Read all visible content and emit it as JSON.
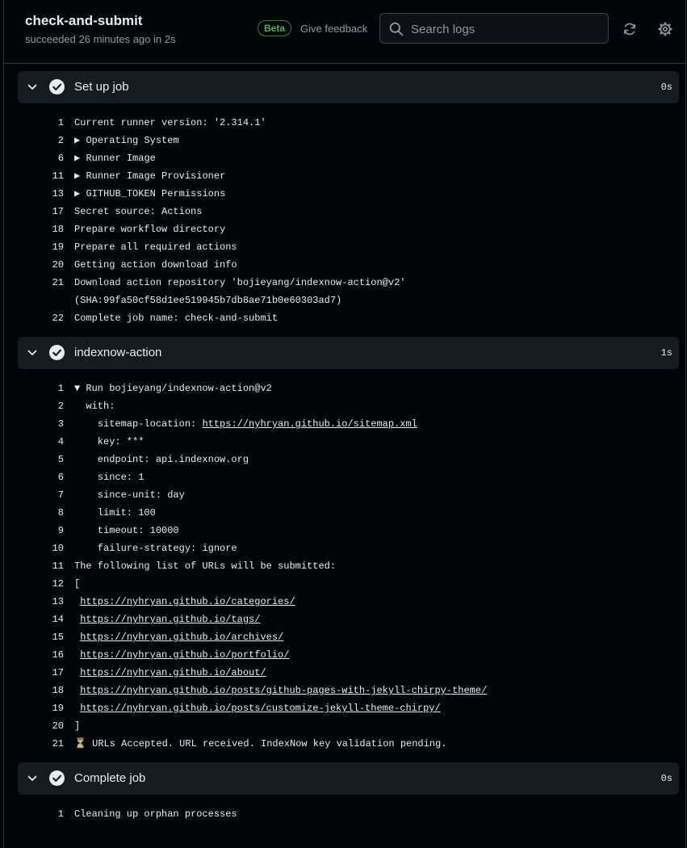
{
  "header": {
    "job_name": "check-and-submit",
    "status": "succeeded 26 minutes ago in 2s",
    "beta_badge": "Beta",
    "feedback_link": "Give feedback",
    "search_placeholder": "Search logs"
  },
  "colors": {
    "background": "#010409",
    "step_header_bg": "#151b23",
    "border": "#30363d",
    "beta_green": "#3fb950"
  },
  "icons": {
    "search": "search-icon",
    "refresh": "refresh-icon",
    "settings": "gear-icon",
    "collapse": "chevron-down-icon",
    "success": "check-circle-icon",
    "pending": "hourglass-icon"
  },
  "steps": [
    {
      "name": "Set up job",
      "duration": "0s",
      "lines": [
        {
          "n": "1",
          "text": "Current runner version: '2.314.1'"
        },
        {
          "n": "2",
          "text": "Operating System",
          "group": true
        },
        {
          "n": "6",
          "text": "Runner Image",
          "group": true
        },
        {
          "n": "11",
          "text": "Runner Image Provisioner",
          "group": true
        },
        {
          "n": "13",
          "text": "GITHUB_TOKEN Permissions",
          "group": true
        },
        {
          "n": "17",
          "text": "Secret source: Actions"
        },
        {
          "n": "18",
          "text": "Prepare workflow directory"
        },
        {
          "n": "19",
          "text": "Prepare all required actions"
        },
        {
          "n": "20",
          "text": "Getting action download info"
        },
        {
          "n": "21",
          "text": "Download action repository 'bojieyang/indexnow-action@v2'"
        },
        {
          "n": "",
          "text": "(SHA:99fa50cf58d1ee519945b7db8ae71b0e60303ad7)"
        },
        {
          "n": "22",
          "text": "Complete job name: check-and-submit"
        }
      ]
    },
    {
      "name": "indexnow-action",
      "duration": "1s",
      "lines": [
        {
          "n": "1",
          "text": "Run bojieyang/indexnow-action@v2",
          "group": true,
          "open": true
        },
        {
          "n": "2",
          "text": "  with:"
        },
        {
          "n": "3",
          "prefix": "    sitemap-location: ",
          "link": "https://nyhryan.github.io/sitemap.xml"
        },
        {
          "n": "4",
          "text": "    key: ***"
        },
        {
          "n": "5",
          "text": "    endpoint: api.indexnow.org"
        },
        {
          "n": "6",
          "text": "    since: 1"
        },
        {
          "n": "7",
          "text": "    since-unit: day"
        },
        {
          "n": "8",
          "text": "    limit: 100"
        },
        {
          "n": "9",
          "text": "    timeout: 10000"
        },
        {
          "n": "10",
          "text": "    failure-strategy: ignore"
        },
        {
          "n": "11",
          "text": "The following list of URLs will be submitted:"
        },
        {
          "n": "12",
          "text": "["
        },
        {
          "n": "13",
          "prefix": " ",
          "link": "https://nyhryan.github.io/categories/"
        },
        {
          "n": "14",
          "prefix": " ",
          "link": "https://nyhryan.github.io/tags/"
        },
        {
          "n": "15",
          "prefix": " ",
          "link": "https://nyhryan.github.io/archives/"
        },
        {
          "n": "16",
          "prefix": " ",
          "link": "https://nyhryan.github.io/portfolio/"
        },
        {
          "n": "17",
          "prefix": " ",
          "link": "https://nyhryan.github.io/about/"
        },
        {
          "n": "18",
          "prefix": " ",
          "link": "https://nyhryan.github.io/posts/github-pages-with-jekyll-chirpy-theme/"
        },
        {
          "n": "19",
          "prefix": " ",
          "link": "https://nyhryan.github.io/posts/customize-jekyll-theme-chirpy/"
        },
        {
          "n": "20",
          "text": "]"
        },
        {
          "n": "21",
          "emoji": "⏳",
          "text": " URLs Accepted. URL received. IndexNow key validation pending."
        }
      ]
    },
    {
      "name": "Complete job",
      "duration": "0s",
      "lines": [
        {
          "n": "1",
          "text": "Cleaning up orphan processes"
        }
      ]
    }
  ]
}
